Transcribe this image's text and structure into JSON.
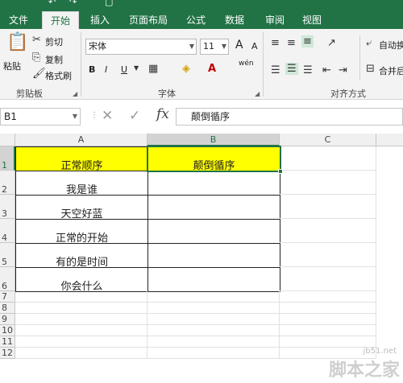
{
  "qat": {
    "undo": "↶",
    "redo": "↷",
    "preview": "▢"
  },
  "tabs": [
    {
      "label": "文件"
    },
    {
      "label": "开始"
    },
    {
      "label": "插入"
    },
    {
      "label": "页面布局"
    },
    {
      "label": "公式"
    },
    {
      "label": "数据"
    },
    {
      "label": "审阅"
    },
    {
      "label": "视图"
    }
  ],
  "ribbon": {
    "clipboard": {
      "paste": "粘贴",
      "cut": "剪切",
      "copy": "复制",
      "format_painter": "格式刷",
      "group": "剪贴板"
    },
    "font": {
      "name": "宋体",
      "size": "11",
      "grow": "A",
      "shrink": "A",
      "bold": "B",
      "italic": "I",
      "underline": "U",
      "wen": "wén",
      "group": "字体"
    },
    "alignment": {
      "wrap": "自动换",
      "merge": "合并后",
      "group": "对齐方式"
    }
  },
  "formula_bar": {
    "cell_ref": "B1",
    "content": "颠倒循序"
  },
  "columns": [
    "A",
    "B",
    "C"
  ],
  "rows": [
    "1",
    "2",
    "3",
    "4",
    "5",
    "6",
    "7",
    "8",
    "9",
    "10",
    "11",
    "12"
  ],
  "cells": {
    "A1": "正常顺序",
    "B1": "颠倒循序",
    "A2": "我是谁",
    "A3": "天空好蓝",
    "A4": "正常的开始",
    "A5": "有的是时间",
    "A6": "你会什么"
  },
  "colors": {
    "accent": "#217346",
    "highlight": "#ffff00"
  },
  "watermark": {
    "main": "脚本之家",
    "url": "jb51.net"
  }
}
